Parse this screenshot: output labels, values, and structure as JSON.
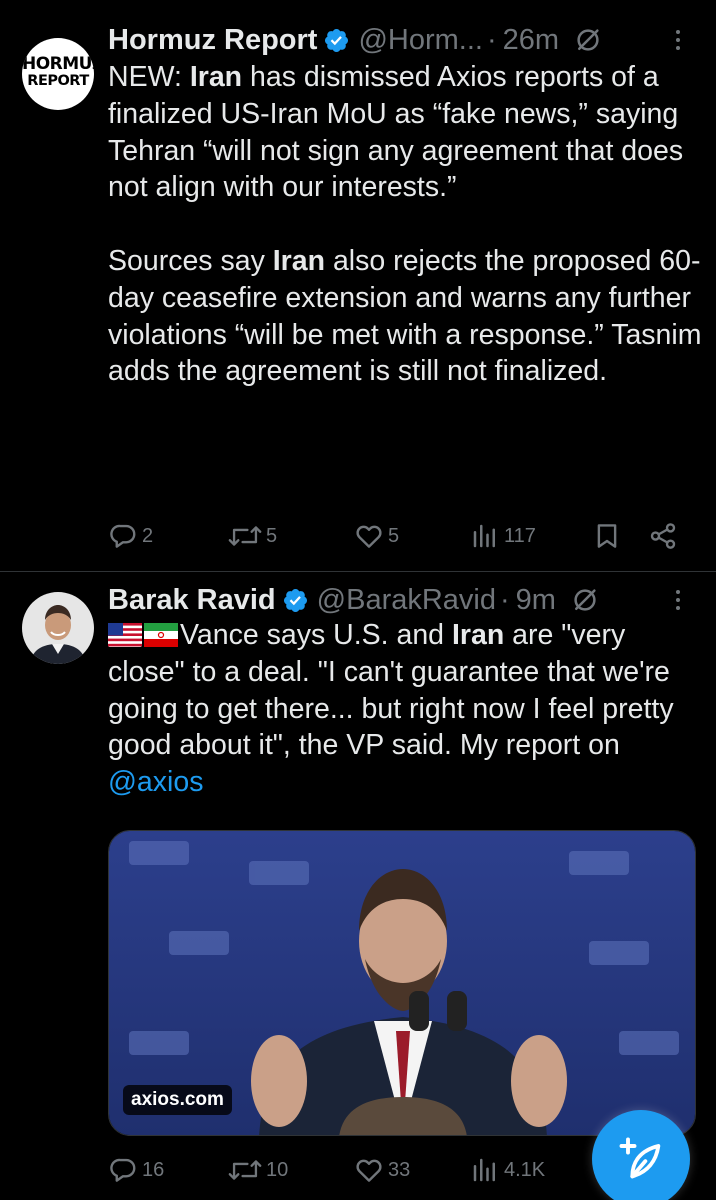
{
  "colors": {
    "background": "#000000",
    "text": "#e7e9ea",
    "muted": "#71767b",
    "accent": "#1d9bf0",
    "divider": "#2f3336"
  },
  "tweets": [
    {
      "avatar_logo": {
        "line1": "HORMUZ",
        "line2": "REPORT"
      },
      "author": "Hormuz Report",
      "handle": "@Horm...",
      "separator": "·",
      "time": "26m",
      "verified_icon": "verified-badge-icon",
      "paragraphs": [
        [
          {
            "text": "NEW: "
          },
          {
            "text": "Iran",
            "bold": true
          },
          {
            "text": " has dismissed Axios reports of a finalized US-Iran MoU as “fake news,” saying Tehran “will not sign any agreement that does not align with our interests.”"
          }
        ],
        [
          {
            "text": "Sources say "
          },
          {
            "text": "Iran",
            "bold": true
          },
          {
            "text": " also rejects the proposed 60-day ceasefire extension and warns any further violations “will be met with a response.” Tasnim adds the agreement is still not finalized."
          }
        ]
      ],
      "actions": {
        "replies": "2",
        "reposts": "5",
        "likes": "5",
        "views": "117"
      }
    },
    {
      "author": "Barak Ravid",
      "handle": "@BarakRavid",
      "separator": "·",
      "time": "9m",
      "verified_icon": "verified-badge-icon",
      "paragraphs": [
        [
          {
            "text": "Vance says U.S. and "
          },
          {
            "text": "Iran",
            "bold": true
          },
          {
            "text": " are \"very close\" to a deal. \"I can't guarantee that we're going to get there... but right now I feel pretty good about it\", the VP said. My report on "
          },
          {
            "text": "@axios",
            "link": true
          }
        ]
      ],
      "flags": [
        "us-flag-icon",
        "iran-flag-icon"
      ],
      "media": {
        "label": "axios.com"
      },
      "actions": {
        "replies": "16",
        "reposts": "10",
        "likes": "33",
        "views": "4.1K"
      }
    }
  ],
  "compose_button": {
    "icon": "compose-plus-icon"
  }
}
